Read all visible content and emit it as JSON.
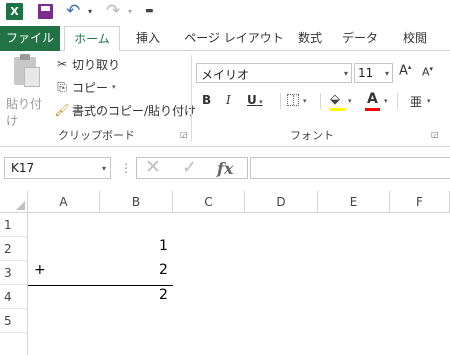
{
  "qat": {
    "logo": "X",
    "undo_icon": "undo-icon",
    "redo_icon": "redo-icon",
    "customize_icon": "customize-qat-icon"
  },
  "tabs": [
    {
      "label": "ファイル"
    },
    {
      "label": "ホーム"
    },
    {
      "label": "挿入"
    },
    {
      "label": "ページ レイアウト"
    },
    {
      "label": "数式"
    },
    {
      "label": "データ"
    },
    {
      "label": "校閲"
    }
  ],
  "clipboard": {
    "paste_label": "貼り付け",
    "cut_label": "切り取り",
    "copy_label": "コピー",
    "format_painter_label": "書式のコピー/貼り付け",
    "group_label": "クリップボード"
  },
  "font": {
    "name": "メイリオ",
    "size": "11",
    "grow_label": "A",
    "shrink_label": "A",
    "bold_label": "B",
    "italic_label": "I",
    "underline_label": "U",
    "font_color_label": "A",
    "phonetic_label": "亜",
    "group_label": "フォント",
    "fill_color": "#ffff00",
    "font_color": "#ff0000"
  },
  "formula_bar": {
    "name_box": "K17",
    "fx_label": "fx",
    "formula": ""
  },
  "grid": {
    "columns": [
      "A",
      "B",
      "C",
      "D",
      "E",
      "F"
    ],
    "rows": [
      "1",
      "2",
      "3",
      "4",
      "5"
    ],
    "cells": {
      "B2": "1",
      "A3": "+",
      "B3": "2",
      "B4": "2"
    }
  },
  "colors": {
    "accent": "#217346"
  }
}
